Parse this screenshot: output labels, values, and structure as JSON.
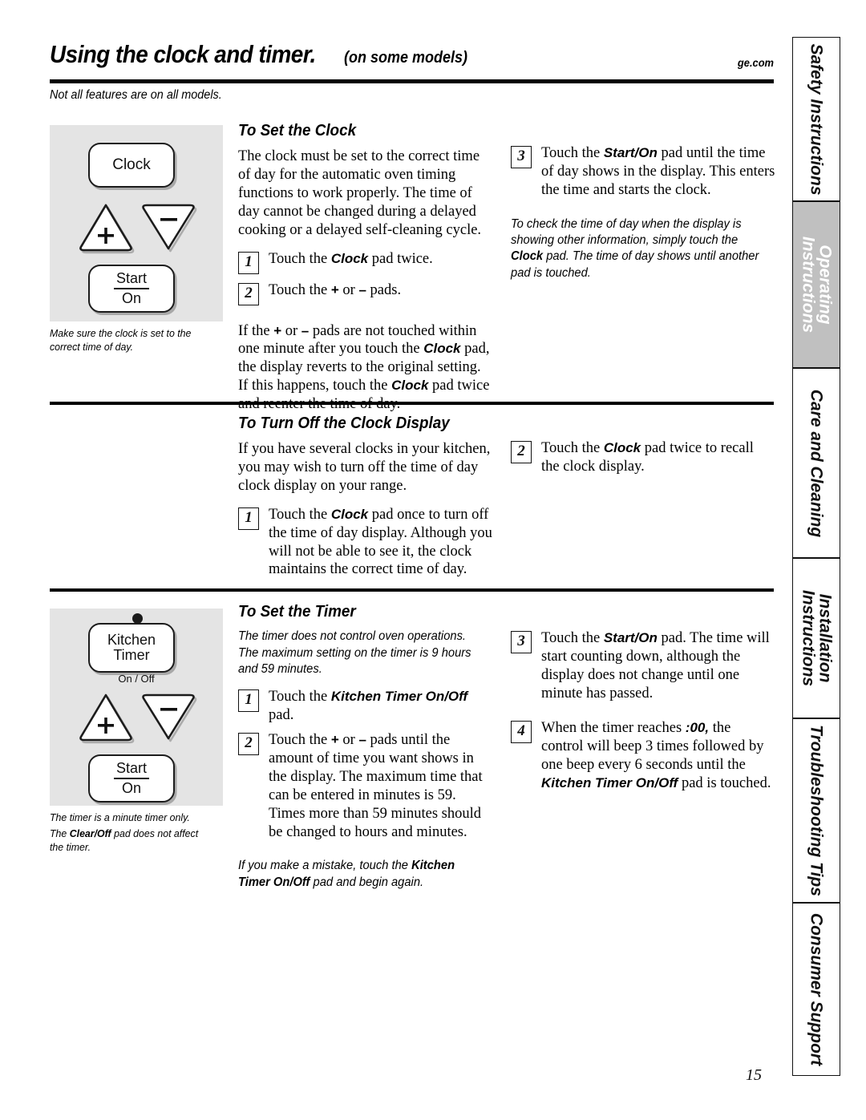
{
  "header": {
    "title_main": "Using the clock and timer.",
    "title_sub": "(on some models)",
    "site_url": "ge.com",
    "subtitle": "Not all features are on all models."
  },
  "illustrations": {
    "clock": {
      "clock_pad": "Clock",
      "plus_pad": "+",
      "minus_pad": "–",
      "start_pad_line1": "Start",
      "start_pad_line2": "On",
      "caption": "Make sure the clock is set to the correct time of day."
    },
    "timer": {
      "timer_pad_line1": "Kitchen",
      "timer_pad_line2": "Timer",
      "timer_pad_sublabel": "On / Off",
      "plus_pad": "+",
      "minus_pad": "–",
      "start_pad_line1": "Start",
      "start_pad_line2": "On",
      "caption_1": "The timer is a minute timer only.",
      "caption_2_pre": "The ",
      "caption_2_bold": "Clear/Off",
      "caption_2_post": " pad does not affect the timer."
    }
  },
  "sections": {
    "set_clock": {
      "heading": "To Set the Clock",
      "intro": "The clock must be set to the correct time of day for the automatic oven timing functions to work properly. The time of day cannot be changed during a delayed cooking or a delayed self-cleaning cycle.",
      "step1_num": "1",
      "step1_pre": "Touch the ",
      "step1_bold": "Clock",
      "step1_post": " pad twice.",
      "step2_num": "2",
      "step2_pre": "Touch the ",
      "step2_sym1": "+",
      "step2_mid": " or ",
      "step2_sym2": "–",
      "step2_post": " pads.",
      "after_pre": "If the ",
      "after_sym1": "+",
      "after_mid1": " or ",
      "after_sym2": "–",
      "after_mid2": " pads are not touched within one minute after you touch the ",
      "after_bold1": "Clock",
      "after_mid3": " pad, the display reverts to the original setting. If this happens, touch the ",
      "after_bold2": "Clock",
      "after_end": " pad twice and reenter the time of day.",
      "step3_num": "3",
      "step3_pre": "Touch the ",
      "step3_bold": "Start/On",
      "step3_post": " pad until the time of day shows in the display. This enters the time and starts the clock.",
      "note_pre": "To check the time of day when the display is showing other information, simply touch the ",
      "note_bold": "Clock",
      "note_post": " pad. The time of day shows until another pad is touched."
    },
    "turn_off_display": {
      "heading": "To Turn Off the Clock Display",
      "intro": "If you have several clocks in your kitchen, you may wish to turn off the time of day clock display on your range.",
      "step1_num": "1",
      "step1_pre": "Touch the ",
      "step1_bold": "Clock",
      "step1_post": " pad once to turn off the time of day display. Although you will not be able to see it, the clock maintains the correct time of day.",
      "step2_num": "2",
      "step2_pre": "Touch the ",
      "step2_bold": "Clock",
      "step2_post": " pad twice to recall the clock display."
    },
    "set_timer": {
      "heading": "To Set the Timer",
      "note_top": "The timer does not control oven operations. The maximum setting on the timer is 9 hours and 59 minutes.",
      "step1_num": "1",
      "step1_pre": "Touch the ",
      "step1_bold": "Kitchen Timer On/Off",
      "step1_post": " pad.",
      "step2_num": "2",
      "step2_pre": "Touch the ",
      "step2_sym1": "+",
      "step2_mid": " or ",
      "step2_sym2": "–",
      "step2_post": " pads until the amount of time you want shows in the display. The maximum time that can be entered in minutes is 59. Times more than 59 minutes should be changed to hours and minutes.",
      "note_bottom_pre": "If you make a mistake, touch the ",
      "note_bottom_bold": "Kitchen Timer On/Off",
      "note_bottom_post": " pad and begin again.",
      "step3_num": "3",
      "step3_pre": "Touch the ",
      "step3_bold": "Start/On",
      "step3_post": " pad. The time will start counting down, although the display does not change until one minute has passed.",
      "step4_num": "4",
      "step4_pre": "When the timer reaches ",
      "step4_bold1": ":00,",
      "step4_mid": " the control will beep 3 times followed by one beep every 6 seconds until the ",
      "step4_bold2": "Kitchen Timer On/Off",
      "step4_post": " pad is touched."
    }
  },
  "sidebar": {
    "tabs": [
      {
        "label": "Safety Instructions",
        "active": false
      },
      {
        "label": "Operating\nInstructions",
        "active": true
      },
      {
        "label": "Care and Cleaning",
        "active": false
      },
      {
        "label": "Installation\nInstructions",
        "active": false
      },
      {
        "label": "Troubleshooting Tips",
        "active": false
      },
      {
        "label": "Consumer Support",
        "active": false
      }
    ]
  },
  "footer": {
    "page_number": "15"
  },
  "colors": {
    "illustration_bg": "#e4e4e4",
    "active_tab_bg": "#c0c0c0",
    "rule": "#000000"
  }
}
